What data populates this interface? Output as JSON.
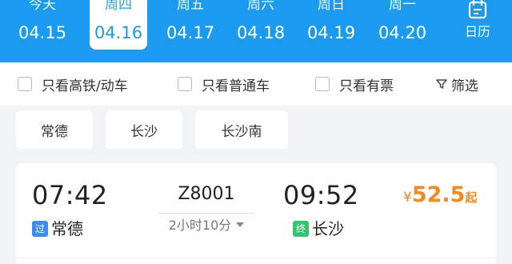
{
  "dates": [
    {
      "weekday": "今天",
      "date": "04.15",
      "selected": false
    },
    {
      "weekday": "周四",
      "date": "04.16",
      "selected": true
    },
    {
      "weekday": "周五",
      "date": "04.17",
      "selected": false
    },
    {
      "weekday": "周六",
      "date": "04.18",
      "selected": false
    },
    {
      "weekday": "周日",
      "date": "04.19",
      "selected": false
    },
    {
      "weekday": "周一",
      "date": "04.20",
      "selected": false
    }
  ],
  "calendar": {
    "label": "日历",
    "icon": "calendar-icon"
  },
  "filters": {
    "high_speed_only": "只看高铁/动车",
    "regular_only": "只看普通车",
    "available_only": "只看有票",
    "screen_label": "筛选",
    "screen_icon": "filter-icon"
  },
  "stations": [
    "常德",
    "长沙",
    "长沙南"
  ],
  "train": {
    "depart_time": "07:42",
    "arrive_time": "09:52",
    "number": "Z8001",
    "duration": "2小时10分",
    "from_tag": "过",
    "from_station": "常德",
    "to_tag": "终",
    "to_station": "长沙",
    "price_currency": "¥",
    "price_value": "52.5",
    "price_suffix": "起"
  },
  "colors": {
    "header_blue": "#1a9bf0",
    "price_orange": "#f08a24",
    "pass_tag_blue": "#3d8cf0",
    "terminal_tag_green": "#35c36b"
  }
}
